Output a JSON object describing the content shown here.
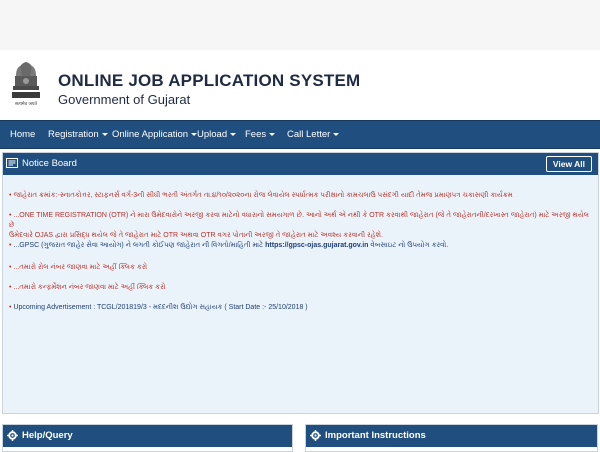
{
  "header": {
    "title": "ONLINE JOB APPLICATION SYSTEM",
    "subtitle": "Government of Gujarat",
    "emblem_caption": "सत्यमेव जयते"
  },
  "nav": {
    "items": [
      {
        "label": "Home"
      },
      {
        "label": "Registration"
      },
      {
        "label": "Online Application"
      },
      {
        "label": "Upload"
      },
      {
        "label": "Fees"
      },
      {
        "label": "Call Letter"
      }
    ]
  },
  "notice_board": {
    "title": "Notice Board",
    "view_all": "View All",
    "items": [
      {
        "text": "જાહેરાત ક્રમાંક:-સ્નાતકોત્તર, સ્ટાફનર્સ વર્ગ-3ની સીધી ભરતી અંતર્ગત તા.૪/૧૦/૨૦૨૦ના રોજ લેવાયેલ સ્પર્ધાત્મક પરીક્ષાનો કામચલાઉ પસંદગી યાદી તેમજ પ્રમાણપત્ર ચકાસણી કાર્યક્રમ"
      },
      {
        "text_a": "...ONE TIME REGISTRATION (OTR) ને મારા ઉમેદવારોને અરજી કરવા માટેનો વધારાનો સમયગાળ છે. આનો અર્થ એ નથી કે OTR કરવાથી જાહેરાત (જે તે જાહેરાતની/દરખાસ્ત જાહેરાત) માટે અરજી થયેલ છે",
        "text_b": "ઉમેદવારે OJAS દ્વારા પ્રસિદ્ધ થયેલ જે તે જાહેરાત માટે OTR અથવા OTR વગર પોતાની અરજી તે જાહેરાત માટે અવશ્ય કરવાની રહેશે."
      },
      {
        "text": "...GPSC (ગુજરાત જાહેર સેવા આયોગ) ને લગતી કોઈપણ જાહેરાત ની વિગતો/માહિતી માટે",
        "url": "https://gpsc-ojas.gujarat.gov.in",
        "text_after": "વેબસાઇટ નો ઉપયોગ કરવો."
      },
      {
        "text": "...તમારો રોલ નંબર જાણવા માટે અહીં ક્લિક કરો"
      },
      {
        "text": "...તમારો કન્ફર્મેશન નંબર જાણવા માટે અહીં ક્લિક કરો"
      },
      {
        "text": "Upcoming Advertisement : TCGL/201819/3 - મદદનીશ ઉદ્યોગ સહાયક ( Start Date :- 25/10/2018 )"
      }
    ]
  },
  "help": {
    "title": "Help/Query"
  },
  "instructions": {
    "title": "Important Instructions"
  },
  "colors": {
    "nav_bg": "#1f4e7f",
    "notice_bg": "#eaf3fa",
    "notice_red": "#b5322a",
    "title_dark": "#1f2a44"
  }
}
